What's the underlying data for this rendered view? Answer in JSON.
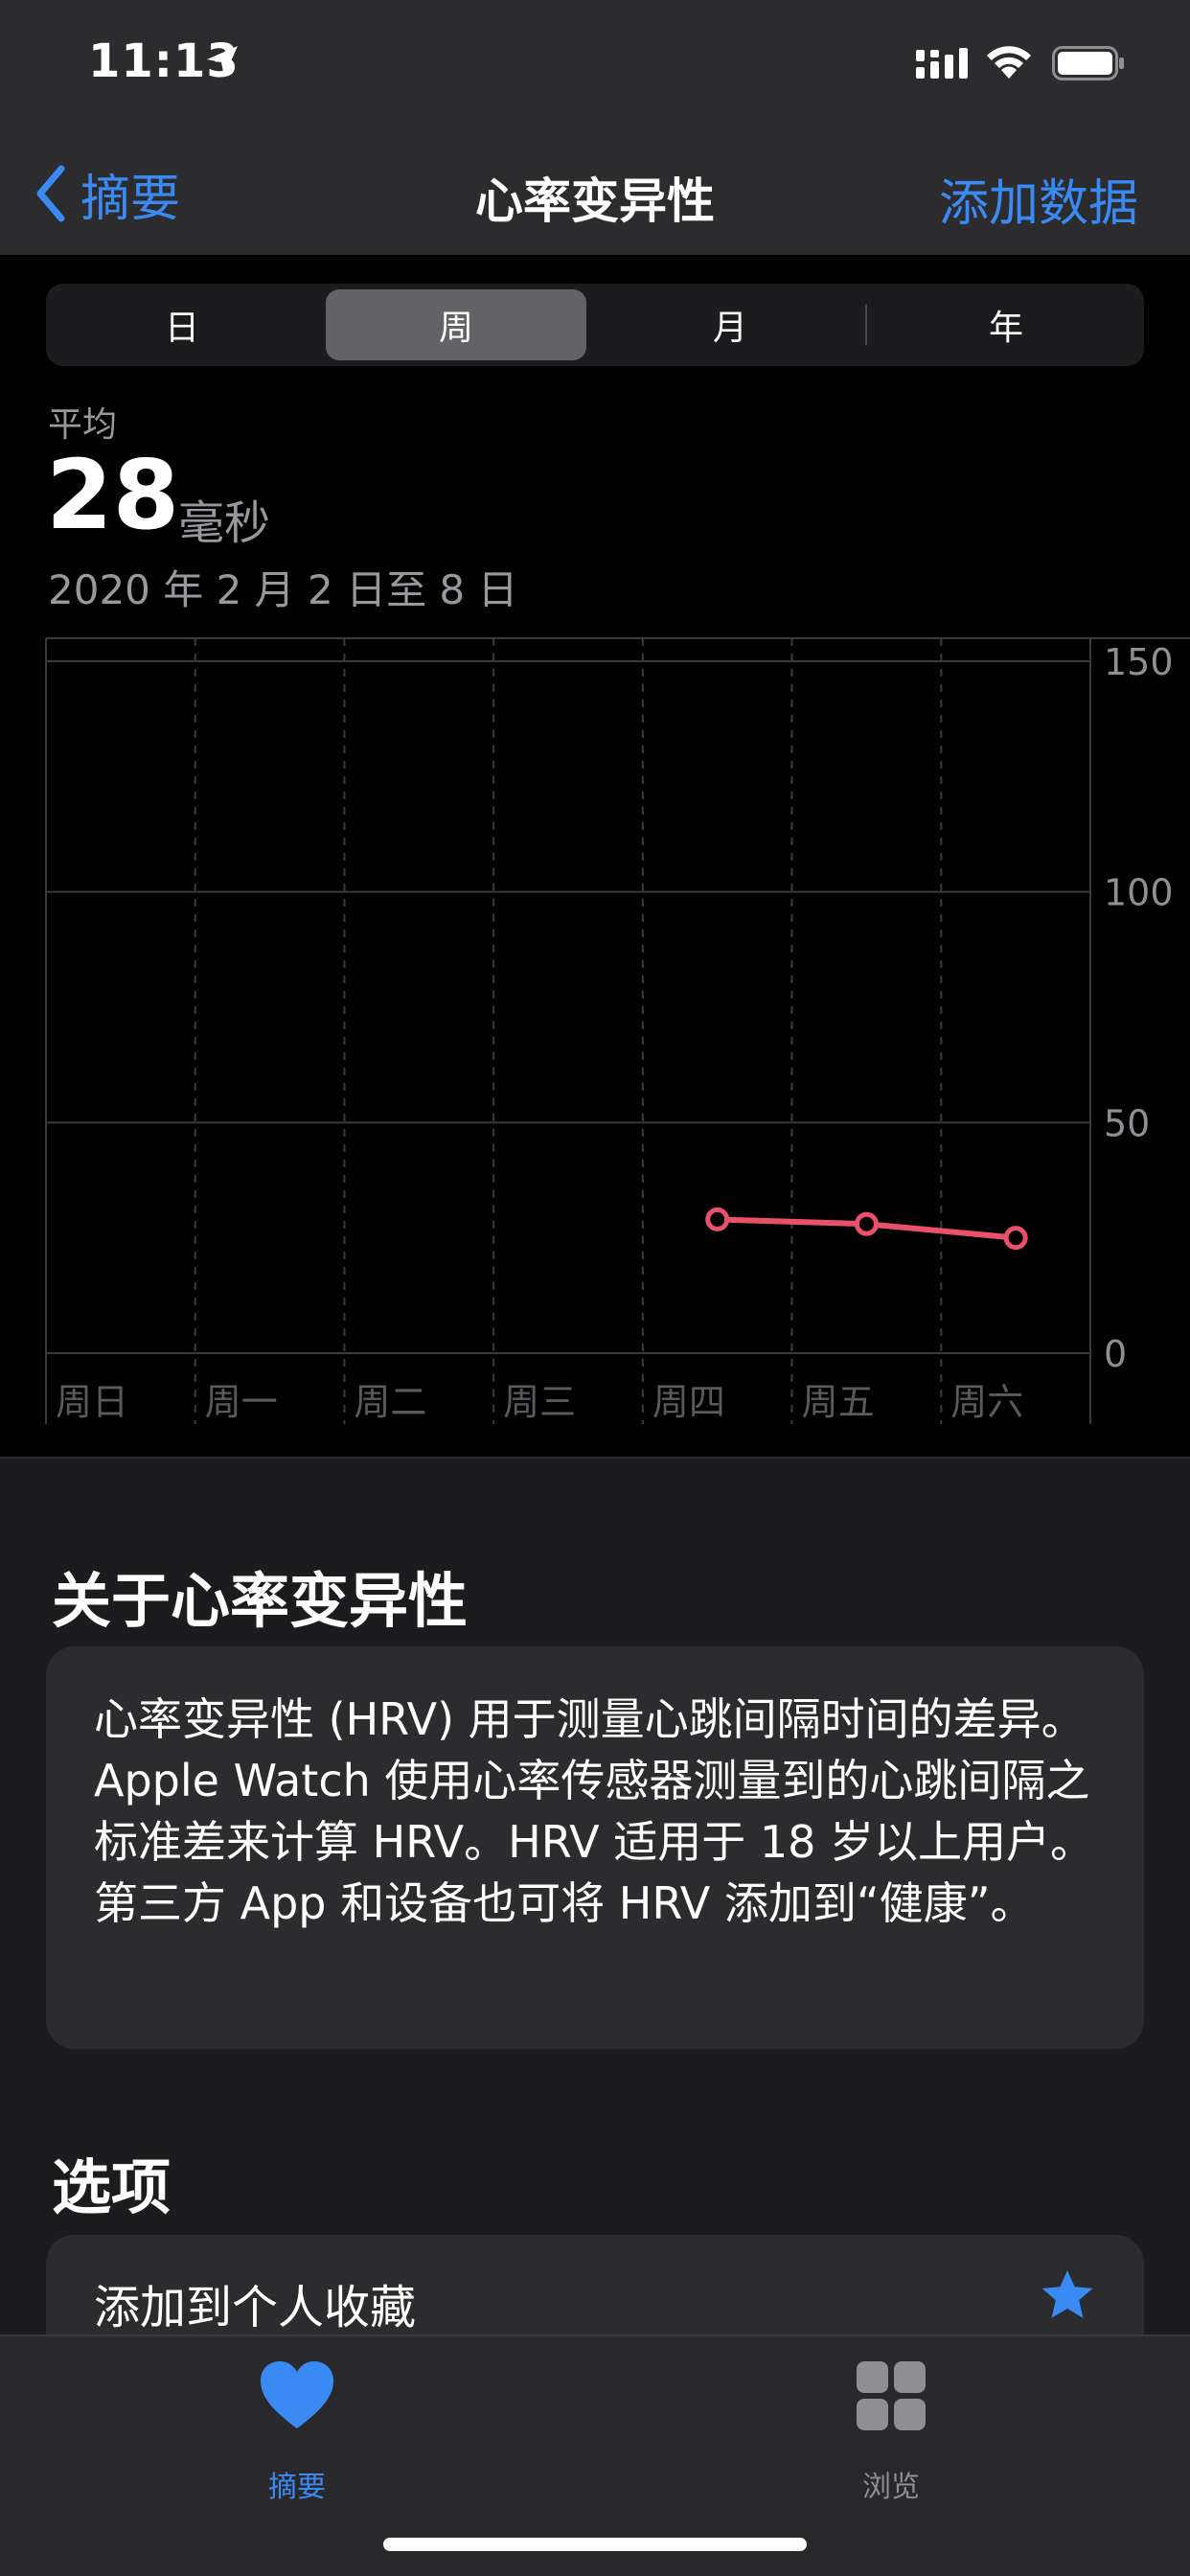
{
  "status_bar": {
    "time": "11:13"
  },
  "nav": {
    "back_label": "摘要",
    "title": "心率变异性",
    "add_data_label": "添加数据"
  },
  "segments": [
    {
      "label": "日",
      "selected": false
    },
    {
      "label": "周",
      "selected": true
    },
    {
      "label": "月",
      "selected": false
    },
    {
      "label": "年",
      "selected": false
    }
  ],
  "summary": {
    "avg_label": "平均",
    "avg_value": "28",
    "avg_unit": "毫秒",
    "date_range": "2020 年 2 月 2 日至 8 日"
  },
  "chart_data": {
    "type": "line",
    "categories": [
      "周日",
      "周一",
      "周二",
      "周三",
      "周四",
      "周五",
      "周六"
    ],
    "series": [
      {
        "values": [
          null,
          null,
          null,
          null,
          29,
          28,
          25
        ],
        "color": "#e9506a"
      }
    ],
    "ylim": [
      0,
      150
    ],
    "yticks": [
      0,
      50,
      100,
      150
    ],
    "grid": true
  },
  "about": {
    "title": "关于心率变异性",
    "text": "心率变异性 (HRV) 用于测量心跳间隔时间的差异。Apple Watch 使用心率传感器测量到的心跳间隔之标准差来计算 HRV。HRV 适用于 18 岁以上用户。第三方 App 和设备也可将 HRV 添加到“健康”。"
  },
  "options": {
    "title": "选项",
    "favorite_label": "添加到个人收藏"
  },
  "tabs": [
    {
      "label": "摘要",
      "icon": "heart-icon",
      "active": true
    },
    {
      "label": "浏览",
      "icon": "grid-icon",
      "active": false
    }
  ],
  "colors": {
    "accent": "#3b8af4",
    "line": "#e9506a",
    "selected_segment": "#636366"
  }
}
